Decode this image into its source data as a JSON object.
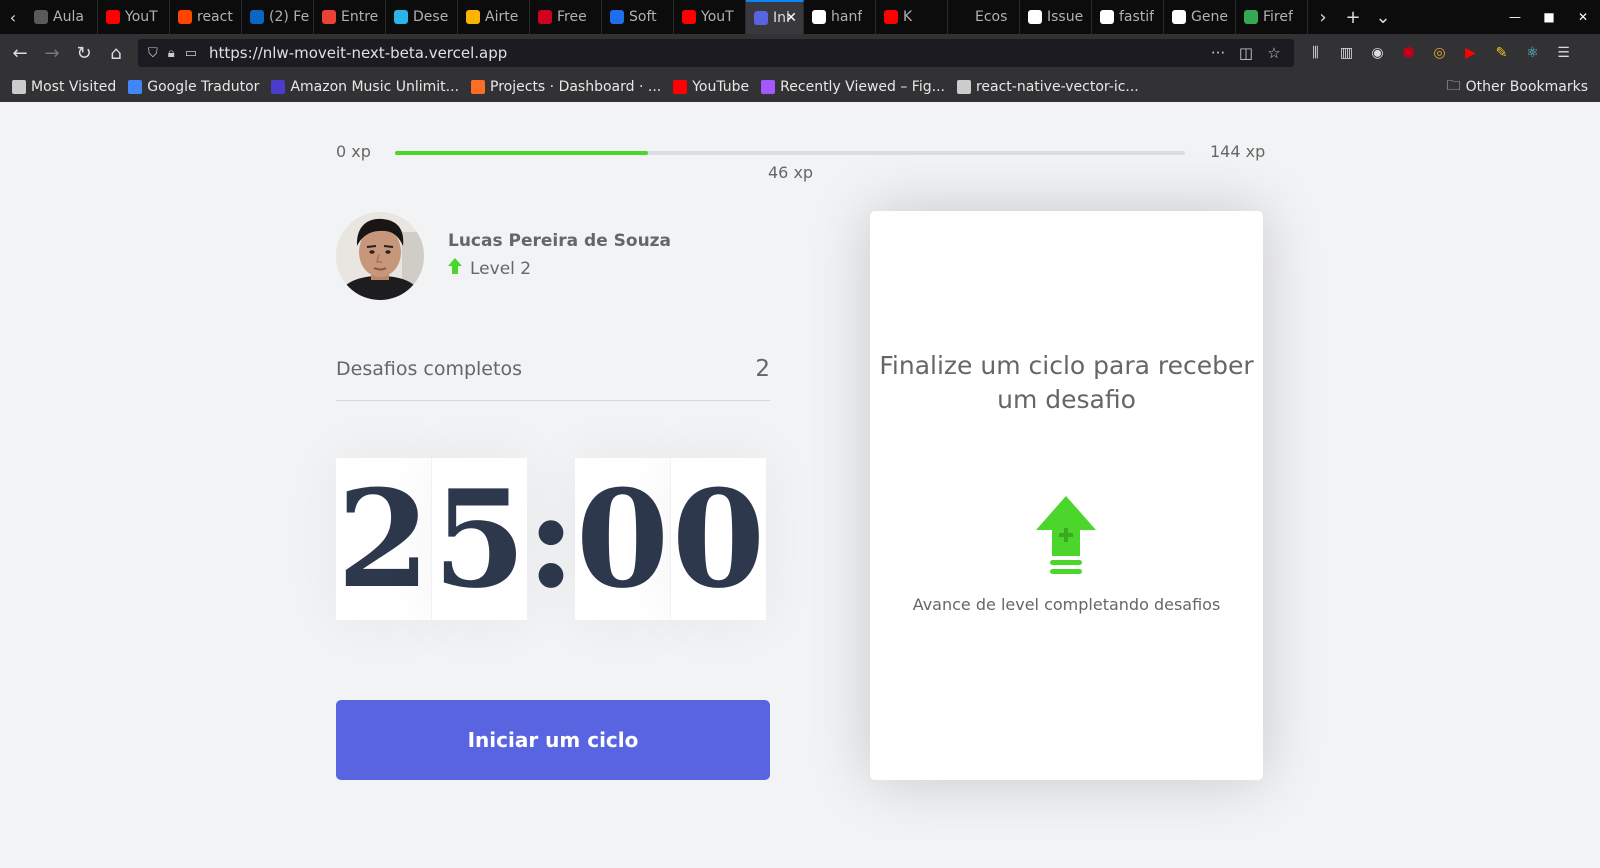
{
  "browser": {
    "tabs": [
      {
        "label": "Aula",
        "icon": "page-icon",
        "color": "#5a5a5a"
      },
      {
        "label": "YouT",
        "icon": "youtube-icon",
        "color": "#ff0000"
      },
      {
        "label": "react",
        "icon": "reddit-icon",
        "color": "#ff4500"
      },
      {
        "label": "(2) Fe",
        "icon": "linkedin-icon",
        "color": "#0a66c2"
      },
      {
        "label": "Entre",
        "icon": "gmail-icon",
        "color": "#ea4335"
      },
      {
        "label": "Dese",
        "icon": "snowflake-icon",
        "color": "#29b5e8"
      },
      {
        "label": "Airte",
        "icon": "airtable-icon",
        "color": "#fcb400"
      },
      {
        "label": "Free",
        "icon": "free-sms-icon",
        "color": "#d1001f"
      },
      {
        "label": "Soft",
        "icon": "cube-icon",
        "color": "#1f6feb"
      },
      {
        "label": "YouT",
        "icon": "youtube-icon",
        "color": "#ff0000"
      },
      {
        "label": "Ini",
        "icon": "moveit-icon",
        "color": "#5965e0",
        "active": true
      },
      {
        "label": "hanf",
        "icon": "github-icon",
        "color": "#ffffff"
      },
      {
        "label": "K",
        "icon": "youtube-icon",
        "color": "#ff0000"
      },
      {
        "label": "Ecos",
        "icon": "page-icon",
        "color": "#0c0c0d"
      },
      {
        "label": "Issue",
        "icon": "github-icon",
        "color": "#ffffff"
      },
      {
        "label": "fastif",
        "icon": "github-icon",
        "color": "#ffffff"
      },
      {
        "label": "Gene",
        "icon": "page-icon",
        "color": "#ffffff"
      },
      {
        "label": "Firef",
        "icon": "play-store-icon",
        "color": "#34a853"
      }
    ],
    "url": "https://nlw-moveit-next-beta.vercel.app",
    "bookmarks": [
      {
        "label": "Most Visited",
        "icon": "gear-icon",
        "color": "#cccccc"
      },
      {
        "label": "Google Tradutor",
        "icon": "google-translate-icon",
        "color": "#4285f4"
      },
      {
        "label": "Amazon Music Unlimit...",
        "icon": "amazon-music-icon",
        "color": "#4a3ccd"
      },
      {
        "label": "Projects · Dashboard · ...",
        "icon": "gitlab-icon",
        "color": "#fc6d26"
      },
      {
        "label": "YouTube",
        "icon": "youtube-icon",
        "color": "#ff0000"
      },
      {
        "label": "Recently Viewed – Fig...",
        "icon": "figma-icon",
        "color": "#a259ff"
      },
      {
        "label": "react-native-vector-ic...",
        "icon": "globe-icon",
        "color": "#cccccc"
      }
    ],
    "other_bookmarks": "Other Bookmarks"
  },
  "xp": {
    "min_label": "0 xp",
    "max_label": "144 xp",
    "current_label": "46 xp",
    "progress_percent": 32,
    "accent_color": "#4cd62b"
  },
  "profile": {
    "name": "Lucas Pereira de Souza",
    "level_label": "Level 2"
  },
  "challenges": {
    "label": "Desafios completos",
    "count": "2"
  },
  "countdown": {
    "minute_left": "2",
    "minute_right": "5",
    "separator": ":",
    "second_left": "0",
    "second_right": "0"
  },
  "start_button": {
    "label": "Iniciar um ciclo",
    "color": "#5965e0"
  },
  "challenge_card": {
    "title": "Finalize um ciclo para receber um desafio",
    "hint": "Avance de level completando desafios",
    "icon": "level-up-icon"
  }
}
